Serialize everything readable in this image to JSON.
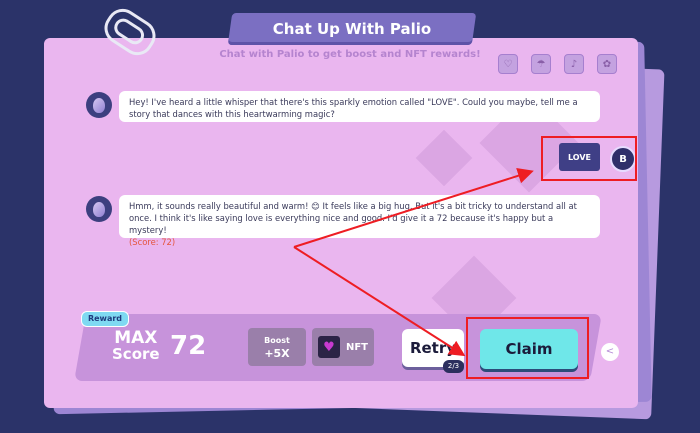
{
  "header": {
    "title": "Chat Up With Palio",
    "subtitle": "Chat with Palio to get boost and NFT rewards!"
  },
  "top_icons": [
    {
      "name": "emotion-icon-1",
      "glyph": "♡"
    },
    {
      "name": "emotion-icon-2",
      "glyph": "☂"
    },
    {
      "name": "emotion-icon-3",
      "glyph": "♪"
    },
    {
      "name": "emotion-icon-4",
      "glyph": "✿"
    }
  ],
  "chat": {
    "message_1": "Hey! I've heard a little whisper that there's this sparkly emotion called \"LOVE\". Could you maybe, tell me a story that dances with this heartwarming magic?",
    "user_reply": "LOVE",
    "user_avatar_letter": "B",
    "message_2": "Hmm, it sounds really beautiful and warm! 😊 It feels like a big hug. But it's a bit tricky to understand all at once. I think it's like saying love is everything nice and good. I'd give it a 72 because it's happy but a mystery!",
    "message_2_score": "(Score: 72)"
  },
  "reward": {
    "tag": "Reward",
    "max_label": "MAX",
    "score_label": "Score",
    "max_score": "72",
    "boost_label": "Boost",
    "boost_value": "+5X",
    "nft_label": "NFT",
    "retry_label": "Retry",
    "retry_count": "2/3",
    "claim_label": "Claim"
  },
  "colors": {
    "background": "#2b3369",
    "card": "#eab6ef",
    "claim": "#6fe7e9",
    "annotation_red": "#ee1d23"
  }
}
